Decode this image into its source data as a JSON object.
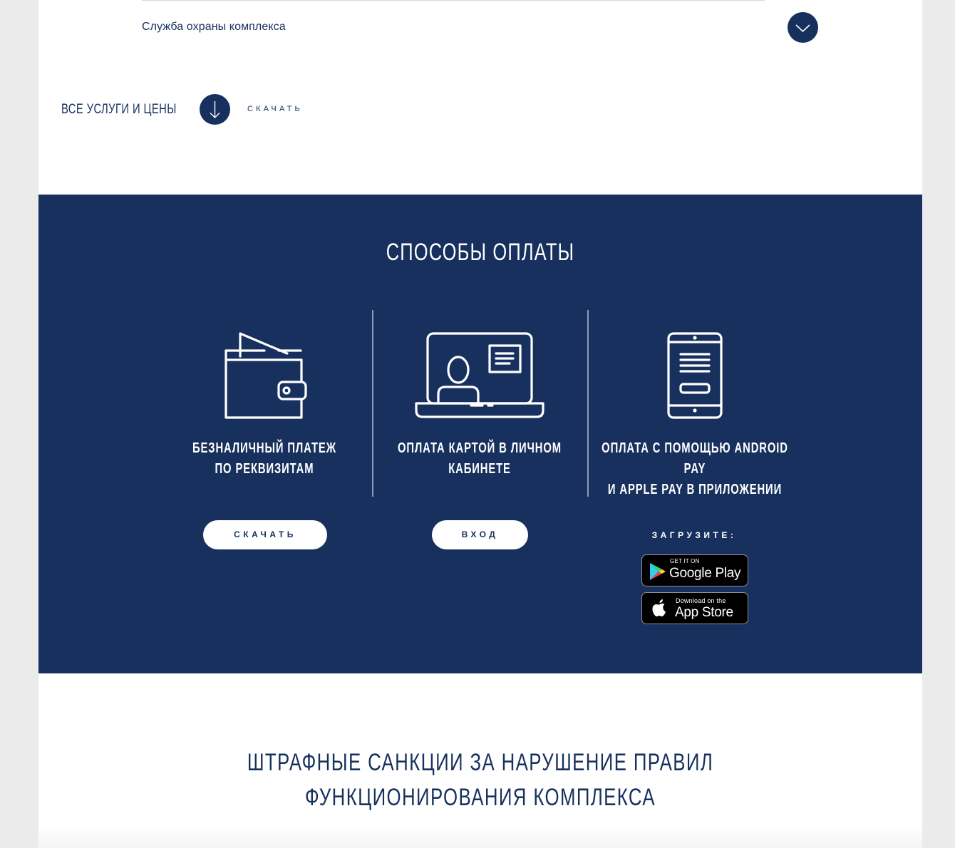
{
  "accordion": {
    "item_title": "Служба охраны комплекса"
  },
  "services": {
    "label": "ВСЕ УСЛУГИ И ЦЕНЫ",
    "download_label": "СКАЧАТЬ"
  },
  "payment": {
    "title": "СПОСОБЫ ОПЛАТЫ",
    "methods": [
      {
        "icon": "wallet-icon",
        "line1": "БЕЗНАЛИЧНЫЙ ПЛАТЕЖ",
        "line2": "ПО РЕКВИЗИТАМ",
        "button": "СКАЧАТЬ"
      },
      {
        "icon": "laptop-account-icon",
        "line1": "ОПЛАТА КАРТОЙ В ЛИЧНОМ",
        "line2": "КАБИНЕТЕ",
        "button": "ВХОД"
      },
      {
        "icon": "smartphone-icon",
        "line1": "ОПЛАТА С ПОМОЩЬЮ ANDROID PAY",
        "line2": "И APPLE PAY В ПРИЛОЖЕНИИ",
        "download_prompt": "ЗАГРУЗИТЕ:"
      }
    ],
    "stores": {
      "google_small": "GET IT ON",
      "google_big": "Google Play",
      "apple_small": "Download on the",
      "apple_big": "App Store"
    }
  },
  "fines": {
    "title_line1": "ШТРАФНЫЕ САНКЦИИ ЗА НАРУШЕНИЕ ПРАВИЛ",
    "title_line2": "ФУНКЦИОНИРОВАНИЯ КОМПЛЕКСА"
  },
  "colors": {
    "brand_navy": "#17305d",
    "page_background": "#ebebeb",
    "white": "#ffffff"
  }
}
